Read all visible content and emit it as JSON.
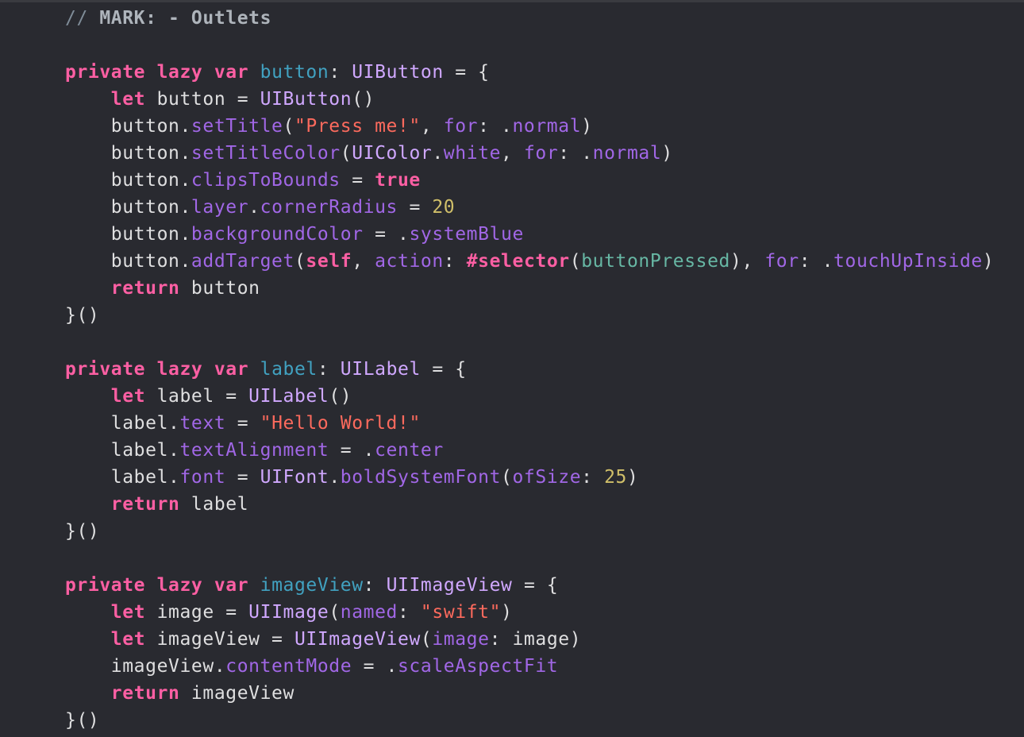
{
  "editor": {
    "background": "#292a30",
    "theme_colors": {
      "plain": "#dfdfe0",
      "comment": "#7f8c98",
      "keyword": "#fc5fa3",
      "declaration": "#41a1c0",
      "type": "#d0a8ff",
      "member": "#a167e6",
      "string": "#fc6a5d",
      "number": "#d0bf69",
      "project_symbol": "#67b7a4",
      "directive": "#fd8f3f"
    },
    "lines": [
      [
        {
          "t": "// ",
          "c": "comment"
        },
        {
          "t": "MARK: - Outlets",
          "c": "mark"
        }
      ],
      [],
      [
        {
          "t": "private",
          "c": "keyword"
        },
        {
          "t": " ",
          "c": "plain"
        },
        {
          "t": "lazy",
          "c": "keyword"
        },
        {
          "t": " ",
          "c": "plain"
        },
        {
          "t": "var",
          "c": "keyword"
        },
        {
          "t": " ",
          "c": "plain"
        },
        {
          "t": "button",
          "c": "decl"
        },
        {
          "t": ": ",
          "c": "plain"
        },
        {
          "t": "UIButton",
          "c": "type"
        },
        {
          "t": " = {",
          "c": "plain"
        }
      ],
      [
        {
          "t": "    ",
          "c": "plain"
        },
        {
          "t": "let",
          "c": "keyword"
        },
        {
          "t": " button = ",
          "c": "plain"
        },
        {
          "t": "UIButton",
          "c": "type"
        },
        {
          "t": "()",
          "c": "plain"
        }
      ],
      [
        {
          "t": "    button.",
          "c": "plain"
        },
        {
          "t": "setTitle",
          "c": "member"
        },
        {
          "t": "(",
          "c": "plain"
        },
        {
          "t": "\"Press me!\"",
          "c": "string"
        },
        {
          "t": ", ",
          "c": "plain"
        },
        {
          "t": "for",
          "c": "param"
        },
        {
          "t": ": .",
          "c": "plain"
        },
        {
          "t": "normal",
          "c": "member"
        },
        {
          "t": ")",
          "c": "plain"
        }
      ],
      [
        {
          "t": "    button.",
          "c": "plain"
        },
        {
          "t": "setTitleColor",
          "c": "member"
        },
        {
          "t": "(",
          "c": "plain"
        },
        {
          "t": "UIColor",
          "c": "type"
        },
        {
          "t": ".",
          "c": "plain"
        },
        {
          "t": "white",
          "c": "member"
        },
        {
          "t": ", ",
          "c": "plain"
        },
        {
          "t": "for",
          "c": "param"
        },
        {
          "t": ": .",
          "c": "plain"
        },
        {
          "t": "normal",
          "c": "member"
        },
        {
          "t": ")",
          "c": "plain"
        }
      ],
      [
        {
          "t": "    button.",
          "c": "plain"
        },
        {
          "t": "clipsToBounds",
          "c": "member"
        },
        {
          "t": " = ",
          "c": "plain"
        },
        {
          "t": "true",
          "c": "keyword"
        }
      ],
      [
        {
          "t": "    button.",
          "c": "plain"
        },
        {
          "t": "layer",
          "c": "member"
        },
        {
          "t": ".",
          "c": "plain"
        },
        {
          "t": "cornerRadius",
          "c": "member"
        },
        {
          "t": " = ",
          "c": "plain"
        },
        {
          "t": "20",
          "c": "number"
        }
      ],
      [
        {
          "t": "    button.",
          "c": "plain"
        },
        {
          "t": "backgroundColor",
          "c": "member"
        },
        {
          "t": " = .",
          "c": "plain"
        },
        {
          "t": "systemBlue",
          "c": "member"
        }
      ],
      [
        {
          "t": "    button.",
          "c": "plain"
        },
        {
          "t": "addTarget",
          "c": "member"
        },
        {
          "t": "(",
          "c": "plain"
        },
        {
          "t": "self",
          "c": "keyword"
        },
        {
          "t": ", ",
          "c": "plain"
        },
        {
          "t": "action",
          "c": "param"
        },
        {
          "t": ": ",
          "c": "plain"
        },
        {
          "t": "#selector",
          "c": "keyword"
        },
        {
          "t": "(",
          "c": "plain"
        },
        {
          "t": "buttonPressed",
          "c": "project"
        },
        {
          "t": "), ",
          "c": "plain"
        },
        {
          "t": "for",
          "c": "param"
        },
        {
          "t": ": .",
          "c": "plain"
        },
        {
          "t": "touchUpInside",
          "c": "member"
        },
        {
          "t": ")",
          "c": "plain"
        }
      ],
      [
        {
          "t": "    ",
          "c": "plain"
        },
        {
          "t": "return",
          "c": "keyword"
        },
        {
          "t": " button",
          "c": "plain"
        }
      ],
      [
        {
          "t": "}()",
          "c": "plain"
        }
      ],
      [],
      [
        {
          "t": "private",
          "c": "keyword"
        },
        {
          "t": " ",
          "c": "plain"
        },
        {
          "t": "lazy",
          "c": "keyword"
        },
        {
          "t": " ",
          "c": "plain"
        },
        {
          "t": "var",
          "c": "keyword"
        },
        {
          "t": " ",
          "c": "plain"
        },
        {
          "t": "label",
          "c": "decl"
        },
        {
          "t": ": ",
          "c": "plain"
        },
        {
          "t": "UILabel",
          "c": "type"
        },
        {
          "t": " = {",
          "c": "plain"
        }
      ],
      [
        {
          "t": "    ",
          "c": "plain"
        },
        {
          "t": "let",
          "c": "keyword"
        },
        {
          "t": " label = ",
          "c": "plain"
        },
        {
          "t": "UILabel",
          "c": "type"
        },
        {
          "t": "()",
          "c": "plain"
        }
      ],
      [
        {
          "t": "    label.",
          "c": "plain"
        },
        {
          "t": "text",
          "c": "member"
        },
        {
          "t": " = ",
          "c": "plain"
        },
        {
          "t": "\"Hello World!\"",
          "c": "string"
        }
      ],
      [
        {
          "t": "    label.",
          "c": "plain"
        },
        {
          "t": "textAlignment",
          "c": "member"
        },
        {
          "t": " = .",
          "c": "plain"
        },
        {
          "t": "center",
          "c": "member"
        }
      ],
      [
        {
          "t": "    label.",
          "c": "plain"
        },
        {
          "t": "font",
          "c": "member"
        },
        {
          "t": " = ",
          "c": "plain"
        },
        {
          "t": "UIFont",
          "c": "type"
        },
        {
          "t": ".",
          "c": "plain"
        },
        {
          "t": "boldSystemFont",
          "c": "member"
        },
        {
          "t": "(",
          "c": "plain"
        },
        {
          "t": "ofSize",
          "c": "param"
        },
        {
          "t": ": ",
          "c": "plain"
        },
        {
          "t": "25",
          "c": "number"
        },
        {
          "t": ")",
          "c": "plain"
        }
      ],
      [
        {
          "t": "    ",
          "c": "plain"
        },
        {
          "t": "return",
          "c": "keyword"
        },
        {
          "t": " label",
          "c": "plain"
        }
      ],
      [
        {
          "t": "}()",
          "c": "plain"
        }
      ],
      [],
      [
        {
          "t": "private",
          "c": "keyword"
        },
        {
          "t": " ",
          "c": "plain"
        },
        {
          "t": "lazy",
          "c": "keyword"
        },
        {
          "t": " ",
          "c": "plain"
        },
        {
          "t": "var",
          "c": "keyword"
        },
        {
          "t": " ",
          "c": "plain"
        },
        {
          "t": "imageView",
          "c": "decl"
        },
        {
          "t": ": ",
          "c": "plain"
        },
        {
          "t": "UIImageView",
          "c": "type"
        },
        {
          "t": " = {",
          "c": "plain"
        }
      ],
      [
        {
          "t": "    ",
          "c": "plain"
        },
        {
          "t": "let",
          "c": "keyword"
        },
        {
          "t": " image = ",
          "c": "plain"
        },
        {
          "t": "UIImage",
          "c": "type"
        },
        {
          "t": "(",
          "c": "plain"
        },
        {
          "t": "named",
          "c": "param"
        },
        {
          "t": ": ",
          "c": "plain"
        },
        {
          "t": "\"swift\"",
          "c": "string"
        },
        {
          "t": ")",
          "c": "plain"
        }
      ],
      [
        {
          "t": "    ",
          "c": "plain"
        },
        {
          "t": "let",
          "c": "keyword"
        },
        {
          "t": " imageView = ",
          "c": "plain"
        },
        {
          "t": "UIImageView",
          "c": "type"
        },
        {
          "t": "(",
          "c": "plain"
        },
        {
          "t": "image",
          "c": "param"
        },
        {
          "t": ": image)",
          "c": "plain"
        }
      ],
      [
        {
          "t": "    imageView.",
          "c": "plain"
        },
        {
          "t": "contentMode",
          "c": "member"
        },
        {
          "t": " = .",
          "c": "plain"
        },
        {
          "t": "scaleAspectFit",
          "c": "member"
        }
      ],
      [
        {
          "t": "    ",
          "c": "plain"
        },
        {
          "t": "return",
          "c": "keyword"
        },
        {
          "t": " imageView",
          "c": "plain"
        }
      ],
      [
        {
          "t": "}()",
          "c": "plain"
        }
      ]
    ]
  }
}
